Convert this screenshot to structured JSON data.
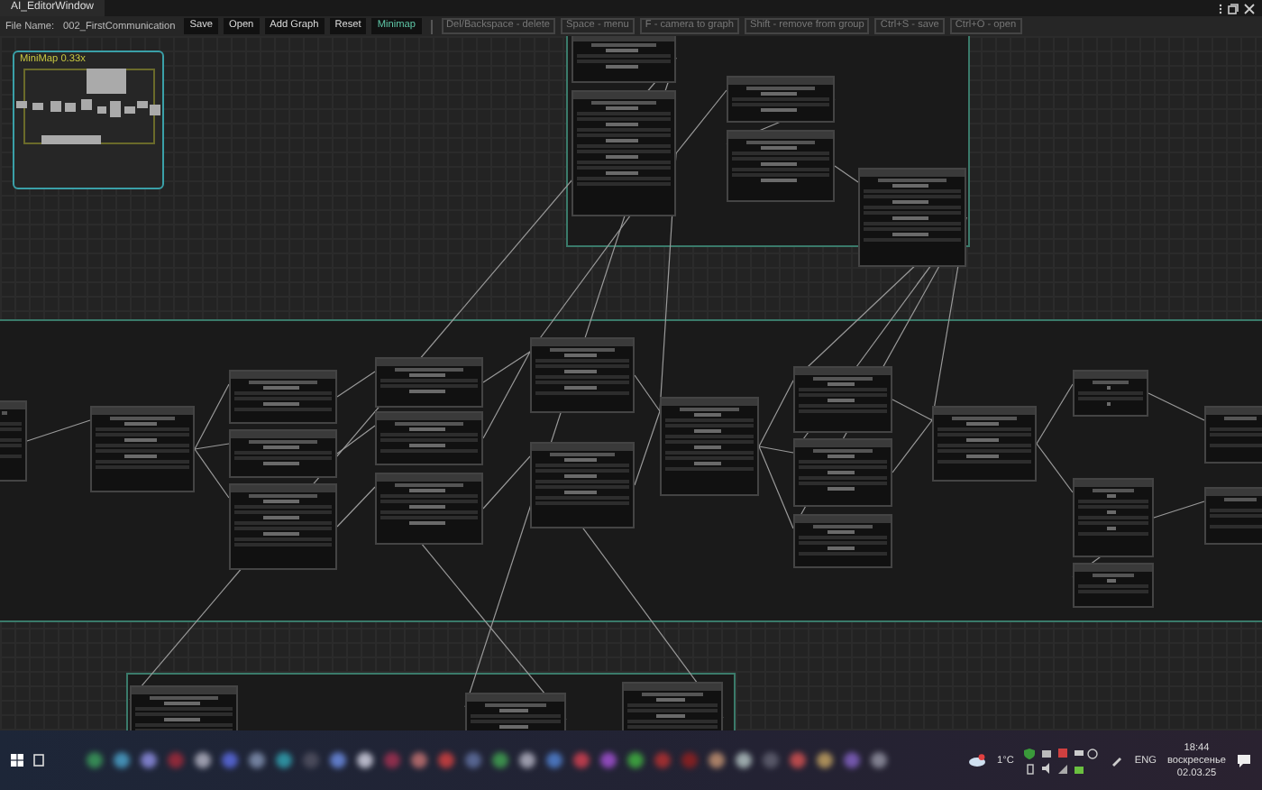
{
  "window": {
    "title": "AI_EditorWindow"
  },
  "toolbar": {
    "file_label": "File Name:",
    "file_name": "002_FirstCommunication",
    "buttons": [
      {
        "label": "Save",
        "selected": false
      },
      {
        "label": "Open",
        "selected": false
      },
      {
        "label": "Add Graph",
        "selected": false
      },
      {
        "label": "Reset",
        "selected": false
      },
      {
        "label": "Minimap",
        "selected": true
      }
    ],
    "hints": [
      "Del/Backspace - delete",
      "Space - menu",
      "F - camera to graph",
      "Shift - remove from group",
      "Ctrl+S - save",
      "Ctrl+O - open"
    ]
  },
  "minimap": {
    "label": "MiniMap  0.33x"
  },
  "taskbar": {
    "weather": "1°C",
    "language": "ENG",
    "time": "18:44",
    "day": "воскресенье",
    "date": "02.03.25"
  }
}
